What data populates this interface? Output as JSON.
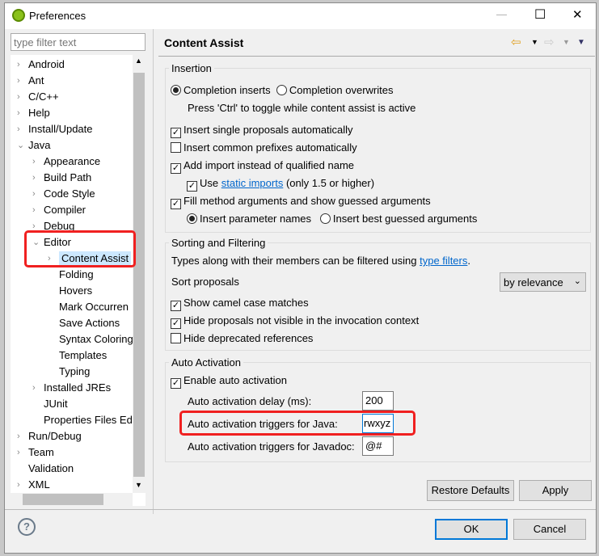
{
  "window": {
    "title": "Preferences",
    "minimize": "—",
    "maximize": "☐",
    "close": "✕"
  },
  "filter": {
    "placeholder": "type filter text"
  },
  "tree": [
    {
      "label": "Android",
      "level": 0,
      "chev": "›"
    },
    {
      "label": "Ant",
      "level": 0,
      "chev": "›"
    },
    {
      "label": "C/C++",
      "level": 0,
      "chev": "›"
    },
    {
      "label": "Help",
      "level": 0,
      "chev": "›"
    },
    {
      "label": "Install/Update",
      "level": 0,
      "chev": "›"
    },
    {
      "label": "Java",
      "level": 0,
      "chev": "⌄"
    },
    {
      "label": "Appearance",
      "level": 1,
      "chev": "›"
    },
    {
      "label": "Build Path",
      "level": 1,
      "chev": "›"
    },
    {
      "label": "Code Style",
      "level": 1,
      "chev": "›"
    },
    {
      "label": "Compiler",
      "level": 1,
      "chev": "›"
    },
    {
      "label": "Debug",
      "level": 1,
      "chev": "›"
    },
    {
      "label": "Editor",
      "level": 1,
      "chev": "⌄"
    },
    {
      "label": "Content Assist",
      "level": 2,
      "chev": "›",
      "selected": true
    },
    {
      "label": "Folding",
      "level": 2,
      "chev": ""
    },
    {
      "label": "Hovers",
      "level": 2,
      "chev": ""
    },
    {
      "label": "Mark Occurren",
      "level": 2,
      "chev": ""
    },
    {
      "label": "Save Actions",
      "level": 2,
      "chev": ""
    },
    {
      "label": "Syntax Coloring",
      "level": 2,
      "chev": ""
    },
    {
      "label": "Templates",
      "level": 2,
      "chev": ""
    },
    {
      "label": "Typing",
      "level": 2,
      "chev": ""
    },
    {
      "label": "Installed JREs",
      "level": 1,
      "chev": "›"
    },
    {
      "label": "JUnit",
      "level": 1,
      "chev": ""
    },
    {
      "label": "Properties Files Ed",
      "level": 1,
      "chev": ""
    },
    {
      "label": "Run/Debug",
      "level": 0,
      "chev": "›"
    },
    {
      "label": "Team",
      "level": 0,
      "chev": "›"
    },
    {
      "label": "Validation",
      "level": 0,
      "chev": ""
    },
    {
      "label": "XML",
      "level": 0,
      "chev": "›"
    }
  ],
  "page": {
    "title": "Content Assist"
  },
  "insertion": {
    "label": "Insertion",
    "completion_inserts": "Completion inserts",
    "completion_overwrites": "Completion overwrites",
    "toggle_hint": "Press 'Ctrl' to toggle while content assist is active",
    "insert_single": "Insert single proposals automatically",
    "insert_common": "Insert common prefixes automatically",
    "add_import": "Add import instead of qualified name",
    "use": "Use",
    "static_imports": "static imports",
    "only15": "(only 1.5 or higher)",
    "fill_method": "Fill method arguments and show guessed arguments",
    "param_names": "Insert parameter names",
    "best_guessed": "Insert best guessed arguments"
  },
  "sorting": {
    "label": "Sorting and Filtering",
    "types_text": "Types along with their members can be filtered using",
    "type_filters": "type filters",
    "period": ".",
    "sort_label": "Sort proposals",
    "sort_value": "by relevance",
    "camel": "Show camel case matches",
    "hide_not_visible": "Hide proposals not visible in the invocation context",
    "hide_deprecated": "Hide deprecated references"
  },
  "auto": {
    "label": "Auto Activation",
    "enable": "Enable auto activation",
    "delay_label": "Auto activation delay (ms):",
    "delay_value": "200",
    "java_label": "Auto activation triggers for Java:",
    "java_value": "rwxyz",
    "javadoc_label": "Auto activation triggers for Javadoc:",
    "javadoc_value": "@#"
  },
  "buttons": {
    "restore": "Restore Defaults",
    "apply": "Apply",
    "ok": "OK",
    "cancel": "Cancel",
    "help": "?"
  },
  "colors": {
    "highlight": "#f02020",
    "selection": "#cce8ff",
    "link": "#0066cc",
    "ok_border": "#0078d7"
  }
}
